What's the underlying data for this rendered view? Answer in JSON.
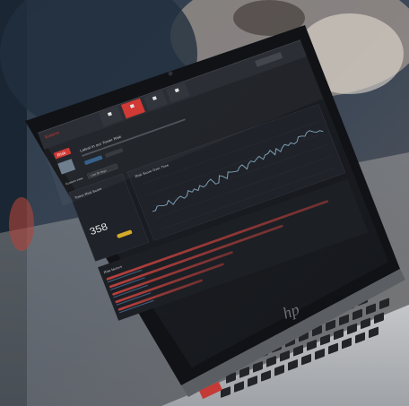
{
  "app": {
    "logo_text": "Exterro",
    "brand_badge": "Risk"
  },
  "nav": {
    "tabs": [
      {
        "label": ""
      },
      {
        "label": ""
      },
      {
        "label": ""
      },
      {
        "label": ""
      }
    ],
    "active_index": 1
  },
  "header": {
    "title": "Latest in our Tower Risk"
  },
  "filter": {
    "label": "Custom view",
    "value": "Last 30 days"
  },
  "tower_score": {
    "title": "Tower Risk Score",
    "value": "358",
    "level_fraction": 0.65
  },
  "trend": {
    "title": "Risk Score Over Time"
  },
  "factors": {
    "title": "Risk factors",
    "bar_fractions": [
      0.92,
      0.72,
      0.5,
      0.45,
      0.35
    ]
  },
  "laptop": {
    "brand_mark": "hp"
  },
  "colors": {
    "accent": "#d0312d",
    "score_badge": "#d4aa2a",
    "trend_line": "#7fa3b8",
    "screen_bg": "#1a1d22"
  }
}
